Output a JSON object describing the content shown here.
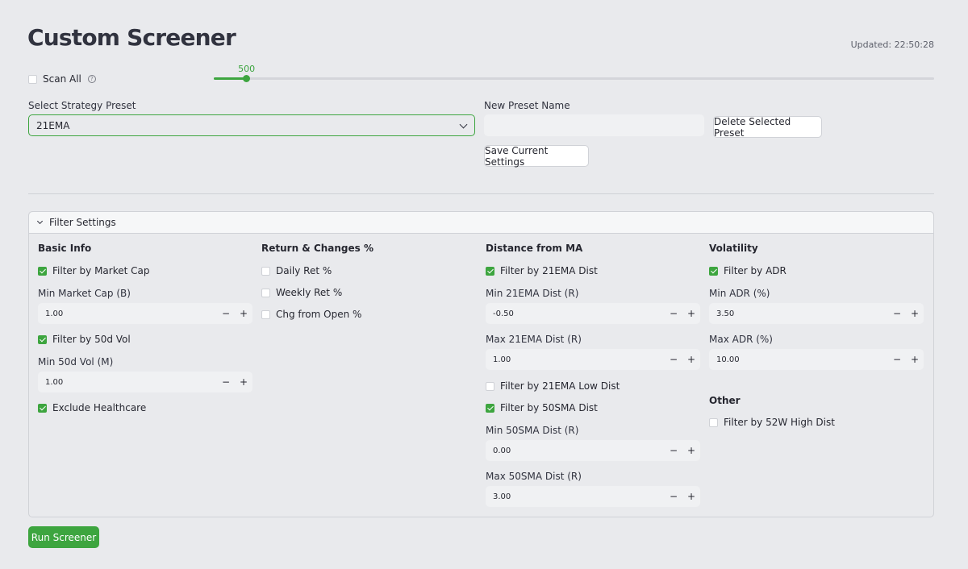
{
  "header": {
    "title": "Custom Screener",
    "updated": "Updated: 22:50:28"
  },
  "scan_all": {
    "label": "Scan All",
    "checked": false
  },
  "slider": {
    "value": "500",
    "min": 0,
    "max": 5000,
    "fraction": 0.045,
    "accent": "#3da53f"
  },
  "preset": {
    "select_label": "Select Strategy Preset",
    "selected": "21EMA",
    "new_name_label": "New Preset Name",
    "new_name_value": "",
    "delete_button": "Delete Selected Preset",
    "save_button": "Save Current Settings"
  },
  "filters": {
    "header": "Filter Settings",
    "basic": {
      "title": "Basic Info",
      "market_cap": {
        "label": "Filter by Market Cap",
        "checked": true
      },
      "min_market_cap": {
        "label": "Min Market Cap (B)",
        "value": "1.00"
      },
      "vol_50d": {
        "label": "Filter by 50d Vol",
        "checked": true
      },
      "min_vol_50d": {
        "label": "Min 50d Vol (M)",
        "value": "1.00"
      },
      "exclude_healthcare": {
        "label": "Exclude Healthcare",
        "checked": true
      }
    },
    "returns": {
      "title": "Return & Changes %",
      "daily": {
        "label": "Daily Ret %",
        "checked": false
      },
      "weekly": {
        "label": "Weekly Ret %",
        "checked": false
      },
      "chg_open": {
        "label": "Chg from Open %",
        "checked": false
      }
    },
    "distance": {
      "title": "Distance from MA",
      "ema21_dist": {
        "label": "Filter by 21EMA Dist",
        "checked": true
      },
      "min_ema21": {
        "label": "Min 21EMA Dist (R)",
        "value": "-0.50"
      },
      "max_ema21": {
        "label": "Max 21EMA Dist (R)",
        "value": "1.00"
      },
      "ema21_low": {
        "label": "Filter by 21EMA Low Dist",
        "checked": false
      },
      "sma50_dist": {
        "label": "Filter by 50SMA Dist",
        "checked": true
      },
      "min_sma50": {
        "label": "Min 50SMA Dist (R)",
        "value": "0.00"
      },
      "max_sma50": {
        "label": "Max 50SMA Dist (R)",
        "value": "3.00"
      }
    },
    "volatility": {
      "title": "Volatility",
      "adr": {
        "label": "Filter by ADR",
        "checked": true
      },
      "min_adr": {
        "label": "Min ADR (%)",
        "value": "3.50"
      },
      "max_adr": {
        "label": "Max ADR (%)",
        "value": "10.00"
      }
    },
    "other": {
      "title": "Other",
      "high_52w": {
        "label": "Filter by 52W High Dist",
        "checked": false
      }
    }
  },
  "stepper": {
    "minus": "−",
    "plus": "+"
  },
  "run_button": "Run Screener"
}
